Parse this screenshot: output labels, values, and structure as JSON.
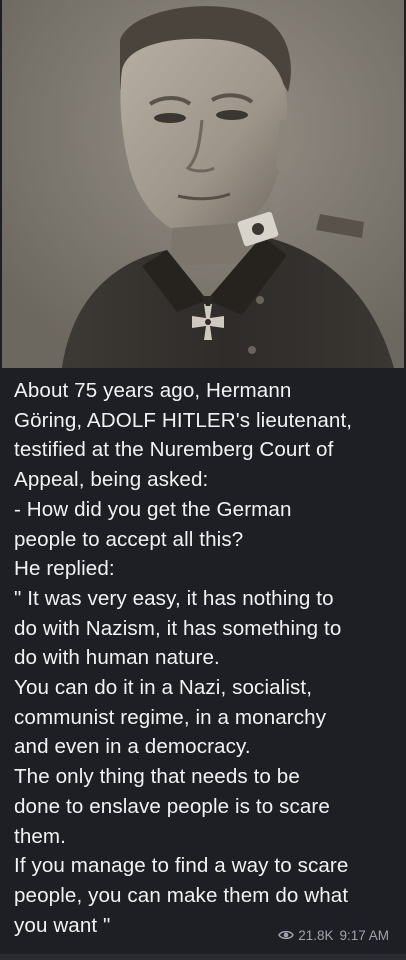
{
  "post": {
    "caption_lines": [
      "About 75 years ago, Hermann",
      "Göring, ADOLF HITLER's lieutenant,",
      "testified at the Nuremberg Court of",
      "Appeal, being asked:",
      "- How did you get the German",
      "people to accept all this?",
      "He replied:",
      "\" It was very easy, it has nothing to",
      "do with Nazism, it has something to",
      "do with human nature.",
      "You can do it in a Nazi, socialist,",
      "communist regime, in a monarchy",
      "and even in a democracy.",
      "The only thing that needs to be",
      "done to enslave people is to scare",
      "them.",
      "If you manage to find a way to scare",
      "people, you can make them do what",
      "you want \""
    ],
    "views": "21.8K",
    "time": "9:17 AM",
    "views_icon": "eye-icon"
  }
}
